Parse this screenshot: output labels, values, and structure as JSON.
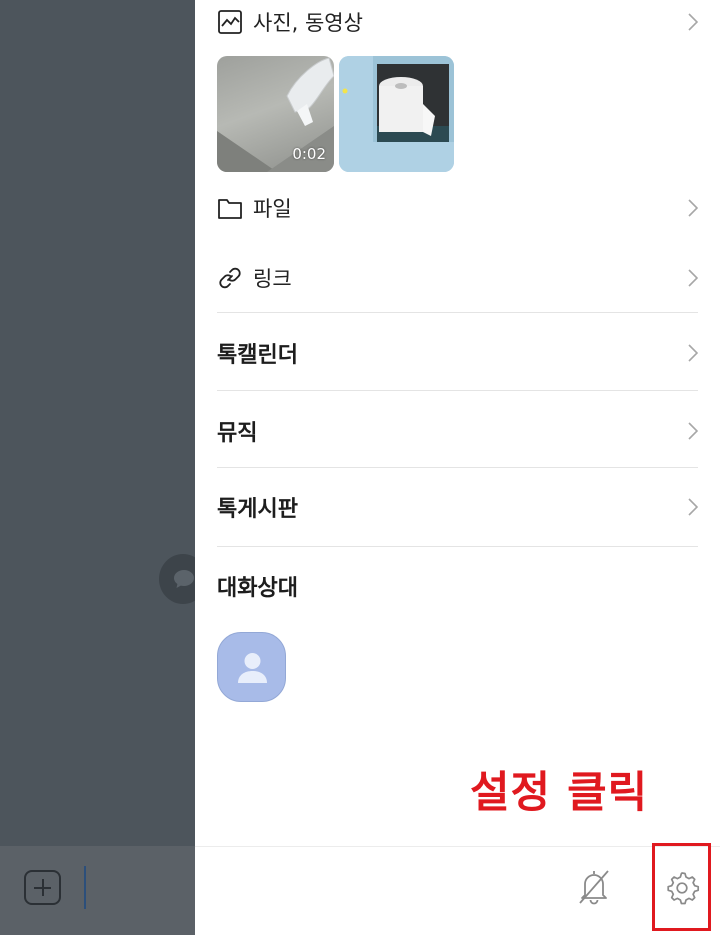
{
  "drawer": {
    "media": {
      "photos_label": "사진, 동영상",
      "video_duration": "0:02",
      "files_label": "파일",
      "links_label": "링크"
    },
    "menu": {
      "calendar_label": "톡캘린더",
      "music_label": "뮤직",
      "board_label": "톡게시판"
    },
    "members": {
      "title": "대화상대"
    }
  },
  "annotation": {
    "text": "설정 클릭",
    "color": "#e0191f"
  },
  "colors": {
    "overlay": "#4d555c",
    "avatar": "#a8bbe8",
    "divider": "#e4e4e4"
  },
  "icons": [
    "image-icon",
    "folder-icon",
    "link-icon",
    "chevron-right-icon",
    "person-icon",
    "bell-off-icon",
    "gear-icon",
    "plus-icon",
    "chat-bubble-icon"
  ]
}
